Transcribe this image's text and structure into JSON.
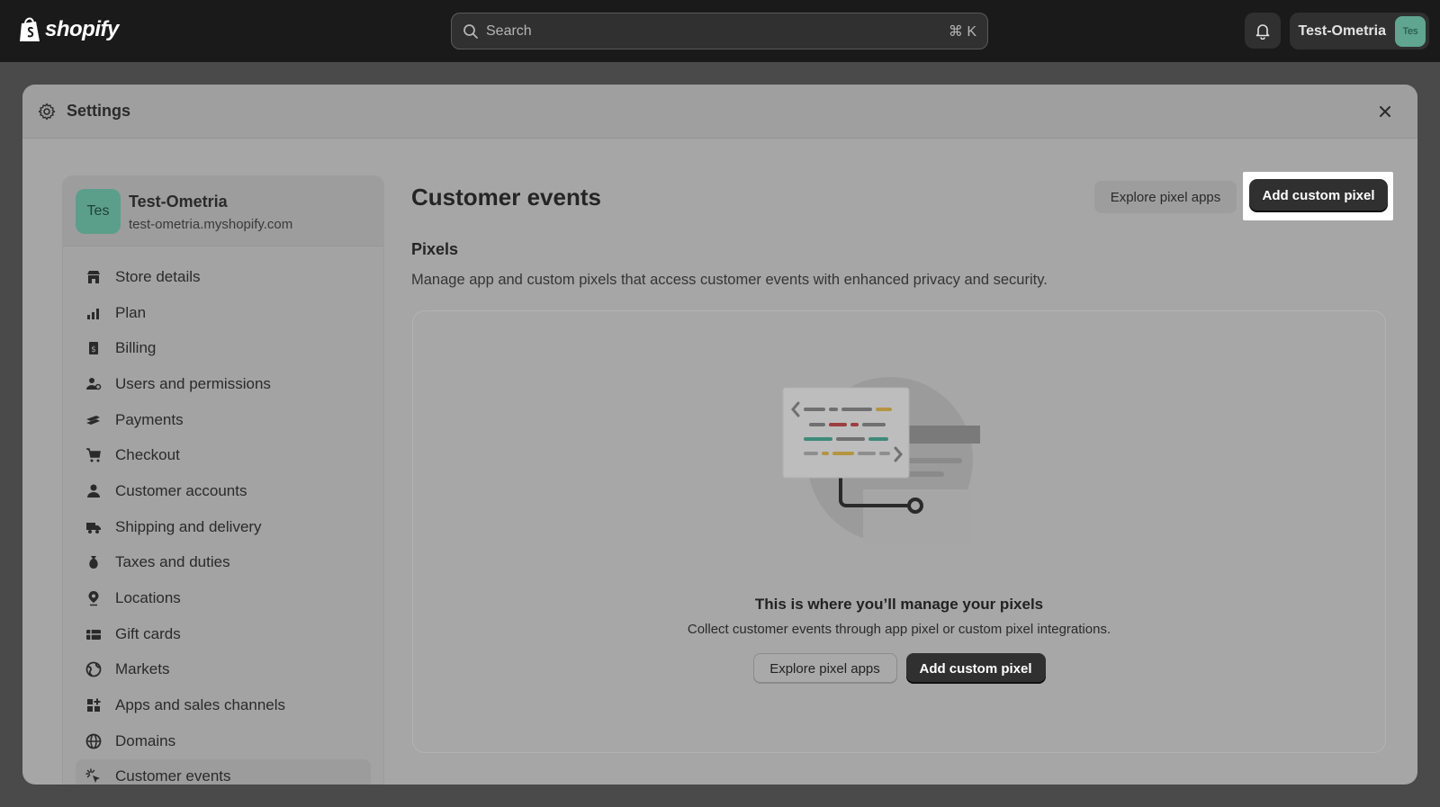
{
  "topbar": {
    "logo_text": "shopify",
    "search_placeholder": "Search",
    "search_shortcut": "⌘ K",
    "account_name": "Test-Ometria",
    "account_initials": "Tes"
  },
  "modal": {
    "title": "Settings"
  },
  "store": {
    "initials": "Tes",
    "name": "Test-Ometria",
    "domain": "test-ometria.myshopify.com"
  },
  "nav": {
    "items": [
      {
        "label": "Store details",
        "icon": "store-icon"
      },
      {
        "label": "Plan",
        "icon": "plan-icon"
      },
      {
        "label": "Billing",
        "icon": "billing-icon"
      },
      {
        "label": "Users and permissions",
        "icon": "users-icon"
      },
      {
        "label": "Payments",
        "icon": "payments-icon"
      },
      {
        "label": "Checkout",
        "icon": "cart-icon"
      },
      {
        "label": "Customer accounts",
        "icon": "person-icon"
      },
      {
        "label": "Shipping and delivery",
        "icon": "truck-icon"
      },
      {
        "label": "Taxes and duties",
        "icon": "taxes-icon"
      },
      {
        "label": "Locations",
        "icon": "location-pin-icon"
      },
      {
        "label": "Gift cards",
        "icon": "gift-card-icon"
      },
      {
        "label": "Markets",
        "icon": "globe-icon"
      },
      {
        "label": "Apps and sales channels",
        "icon": "apps-icon"
      },
      {
        "label": "Domains",
        "icon": "domains-icon"
      },
      {
        "label": "Customer events",
        "icon": "cursor-click-icon"
      }
    ],
    "active_index": 14
  },
  "main": {
    "title": "Customer events",
    "explore_label": "Explore pixel apps",
    "add_label": "Add custom pixel",
    "section_title": "Pixels",
    "section_desc": "Manage app and custom pixels that access customer events with enhanced privacy and security.",
    "empty_title": "This is where you’ll manage your pixels",
    "empty_desc": "Collect customer events through app pixel or custom pixel integrations.",
    "empty_explore_label": "Explore pixel apps",
    "empty_add_label": "Add custom pixel"
  },
  "colors": {
    "topbar_bg": "#1a1a1a",
    "primary_button": "#303030",
    "avatar_green": "#5b9f8a"
  }
}
